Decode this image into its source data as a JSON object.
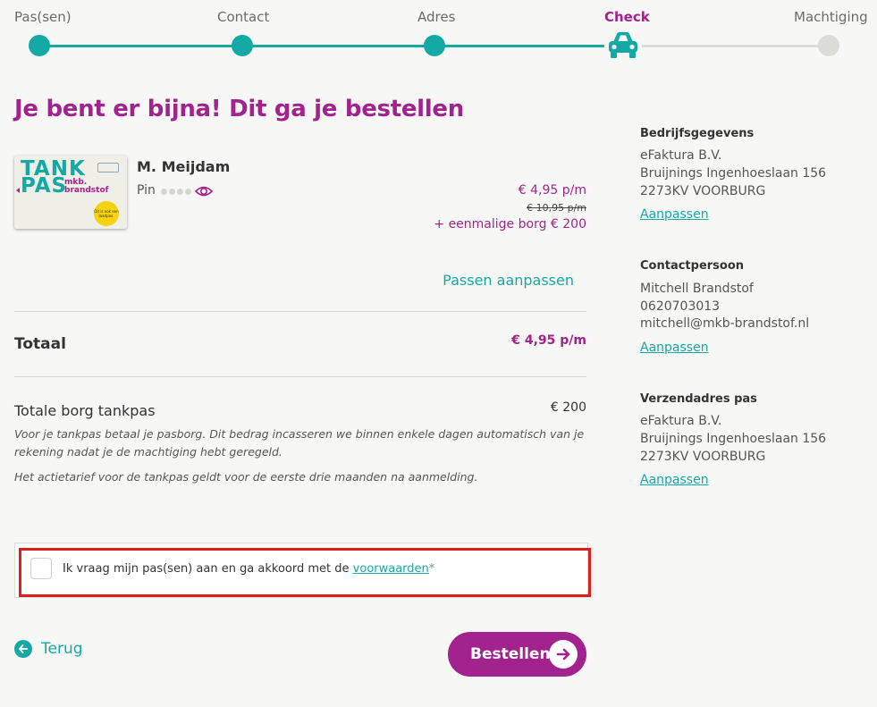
{
  "colors": {
    "teal": "#14a9a5",
    "purple": "#a3238e",
    "inactive": "#dcdcd6",
    "highlight": "#e21b1b"
  },
  "steps": [
    {
      "label": "Pas(sen)",
      "state": "done"
    },
    {
      "label": "Contact",
      "state": "done"
    },
    {
      "label": "Adres",
      "state": "done"
    },
    {
      "label": "Check",
      "state": "active",
      "icon": "car-icon"
    },
    {
      "label": "Machtiging",
      "state": "todo"
    }
  ],
  "main": {
    "title": "Je bent er bijna! Dit ga je bestellen",
    "card": {
      "brand_line1": "TANK",
      "brand_line2": "PAS",
      "brand_sub_1": "mkb.",
      "brand_sub_2": "brandstof",
      "sticker": "Dit is ook een laadpas."
    },
    "holder_name": "M. Meijdam",
    "pin_label": "Pin",
    "price": "€ 4,95 p/m",
    "old_price": "€ 10,95 p/m",
    "deposit_line": "+ eenmalige borg € 200",
    "adjust_cards": "Passen aanpassen",
    "total_label": "Totaal",
    "total_value": "€ 4,95 p/m",
    "deposit_title": "Totale borg tankpas",
    "deposit_value": "€ 200",
    "note1": "Voor je tankpas betaal je pasborg. Dit bedrag incasseren we binnen enkele dagen automatisch van je rekening nadat je de machtiging hebt geregeld.",
    "note2": "Het actietarief voor de tankpas geldt voor de eerste drie maanden na aanmelding.",
    "agree_text": "Ik vraag mijn pas(sen) aan en ga akkoord met de",
    "agree_link": "voorwaarden",
    "agree_required": "*",
    "agree_checked": false,
    "back_label": "Terug",
    "order_label": "Bestellen"
  },
  "sidebar": {
    "company": {
      "heading": "Bedrijfsgegevens",
      "lines": [
        "eFaktura B.V.",
        "Bruijnings Ingenhoeslaan 156",
        "2273KV VOORBURG"
      ],
      "edit": "Aanpassen"
    },
    "contact": {
      "heading": "Contactpersoon",
      "lines": [
        "Mitchell Brandstof",
        "0620703013",
        "mitchell@mkb-brandstof.nl"
      ],
      "edit": "Aanpassen"
    },
    "shipping": {
      "heading": "Verzendadres pas",
      "lines": [
        "eFaktura B.V.",
        "Bruijnings Ingenhoeslaan 156",
        "2273KV VOORBURG"
      ],
      "edit": "Aanpassen"
    }
  }
}
